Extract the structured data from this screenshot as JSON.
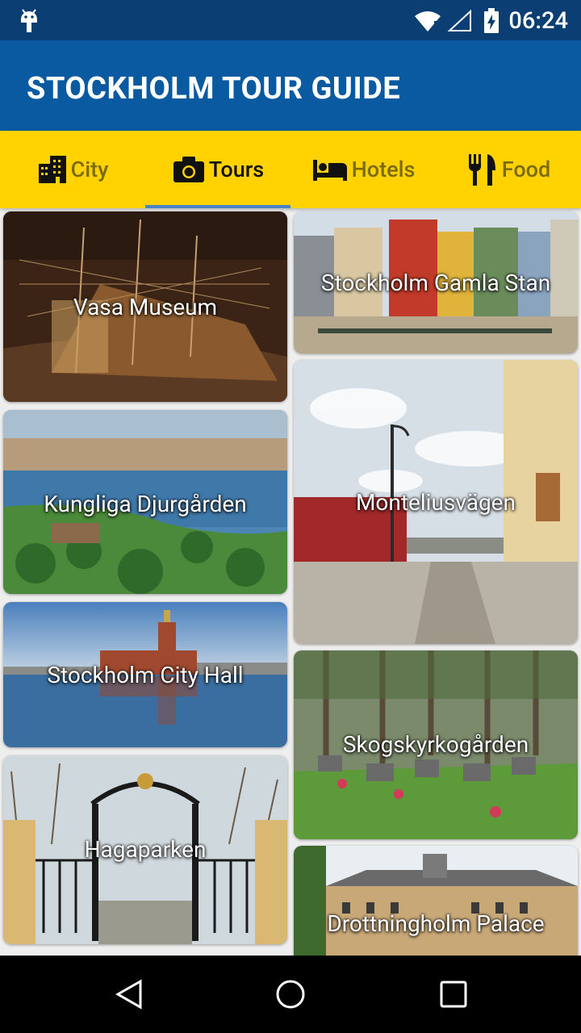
{
  "status_bar": {
    "time": "06:24",
    "icons": [
      "android-icon",
      "wifi-icon",
      "signal-icon",
      "battery-icon"
    ]
  },
  "app_bar": {
    "title": "STOCKHOLM TOUR GUIDE"
  },
  "tabs": [
    {
      "label": "City",
      "icon": "city-icon",
      "active": false
    },
    {
      "label": "Tours",
      "icon": "camera-icon",
      "active": true
    },
    {
      "label": "Hotels",
      "icon": "bed-icon",
      "active": false
    },
    {
      "label": "Food",
      "icon": "fork-knife-icon",
      "active": false
    }
  ],
  "places": {
    "left": [
      {
        "name": "Vasa Museum"
      },
      {
        "name": "Kungliga Djurgården"
      },
      {
        "name": "Stockholm City Hall"
      },
      {
        "name": "Hagaparken"
      }
    ],
    "right": [
      {
        "name": "Stockholm Gamla Stan"
      },
      {
        "name": "Monteliusvägen"
      },
      {
        "name": "Skogskyrkogården"
      },
      {
        "name": "Drottningholm Palace"
      }
    ]
  },
  "nav_bar": {
    "buttons": [
      "back-icon",
      "home-icon",
      "recents-icon"
    ]
  },
  "colors": {
    "status_bar": "#0b3f73",
    "app_bar": "#0a5aa1",
    "tab_bar": "#ffd200",
    "tab_indicator": "#4a84c4"
  }
}
